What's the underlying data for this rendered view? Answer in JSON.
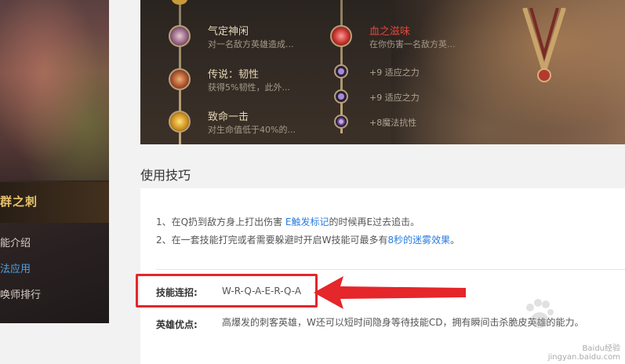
{
  "left": {
    "name": "群之刺",
    "nav": [
      {
        "label": "能介绍",
        "active": false
      },
      {
        "label": "法应用",
        "active": true
      },
      {
        "label": "唤师排行",
        "active": false
      }
    ]
  },
  "runes": {
    "left_column": [
      {
        "title": "气定神闲",
        "desc": "对一名敌方英雄造成...",
        "icon": "rune-presence-icon"
      },
      {
        "title": "传说：韧性",
        "desc": "获得5%韧性，此外...",
        "icon": "rune-legend-tenacity-icon"
      },
      {
        "title": "致命一击",
        "desc": "对生命值低于40%的...",
        "icon": "rune-coup-de-grace-icon"
      }
    ],
    "right_column": [
      {
        "title": "血之滋味",
        "desc": "在你伤害一名敌方英...",
        "icon": "rune-taste-of-blood-icon"
      }
    ],
    "stats": [
      {
        "text": "+9 适应之力",
        "icon": "adaptive-force-icon"
      },
      {
        "text": "+9 适应之力",
        "icon": "adaptive-force-icon"
      },
      {
        "text": "+8魔法抗性",
        "icon": "magic-resist-icon"
      }
    ]
  },
  "tips": {
    "section_title": "使用技巧",
    "tip1_prefix": "1、在Q扔到敌方身上打出伤害 ",
    "tip1_hl": "E触发标记",
    "tip1_suffix": "的时候再E过去追击。",
    "tip2_prefix": "2、在一套技能打完或者需要躲避时开启W技能可最多有",
    "tip2_hl": "8秒的迷雾效果",
    "tip2_suffix": "。",
    "combo_label": "技能连招:",
    "combo_value": "W-R-Q-A-E-R-Q-A",
    "advantage_label": "英雄优点:",
    "advantage_text": "高爆发的刺客英雄，W还可以短时间隐身等待技能CD，拥有瞬间击杀脆皮英雄的能力。"
  },
  "watermark": {
    "line1": "Baidu经验",
    "line2": "jingyan.baidu.com"
  },
  "colors": {
    "highlight": "#2a7de1",
    "annotation": "#e5262a",
    "rune_red": "#e0473e"
  }
}
